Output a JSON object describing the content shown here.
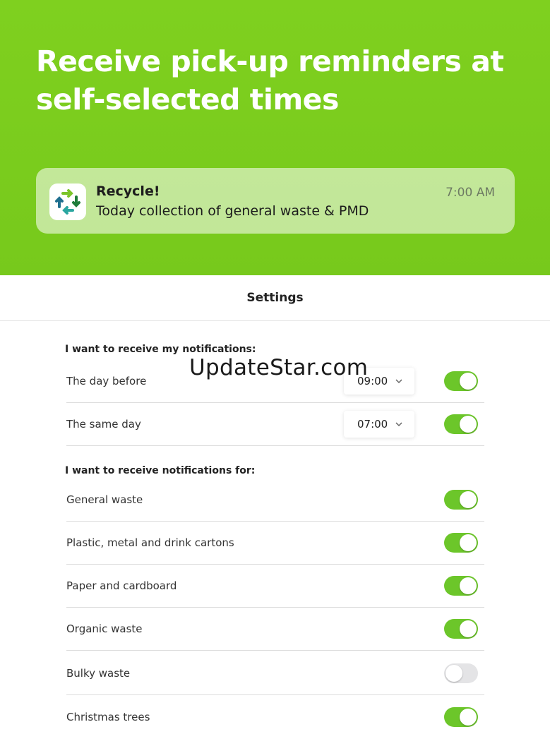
{
  "hero": {
    "title": "Receive pick-up reminders at self-selected times",
    "background_color": "#7fd01f"
  },
  "notification": {
    "app_name": "Recycle!",
    "message": "Today collection of general waste & PMD",
    "time": "7:00 AM",
    "icon": "recycle-arrows-icon"
  },
  "settings": {
    "title": "Settings",
    "timing_section": {
      "label": "I want to receive my notifications:",
      "rows": [
        {
          "label": "The day before",
          "time": "09:00",
          "enabled": true
        },
        {
          "label": "The same day",
          "time": "07:00",
          "enabled": true
        }
      ]
    },
    "types_section": {
      "label": "I want to receive notifications for:",
      "rows": [
        {
          "label": "General waste",
          "enabled": true
        },
        {
          "label": "Plastic, metal and drink cartons",
          "enabled": true
        },
        {
          "label": "Paper and cardboard",
          "enabled": true
        },
        {
          "label": "Organic waste",
          "enabled": true
        },
        {
          "label": "Bulky waste",
          "enabled": false
        },
        {
          "label": "Christmas trees",
          "enabled": true
        }
      ]
    }
  },
  "watermark": "UpdateStar.com",
  "colors": {
    "toggle_on": "#6cc62a",
    "toggle_off": "#e4e4e6"
  }
}
